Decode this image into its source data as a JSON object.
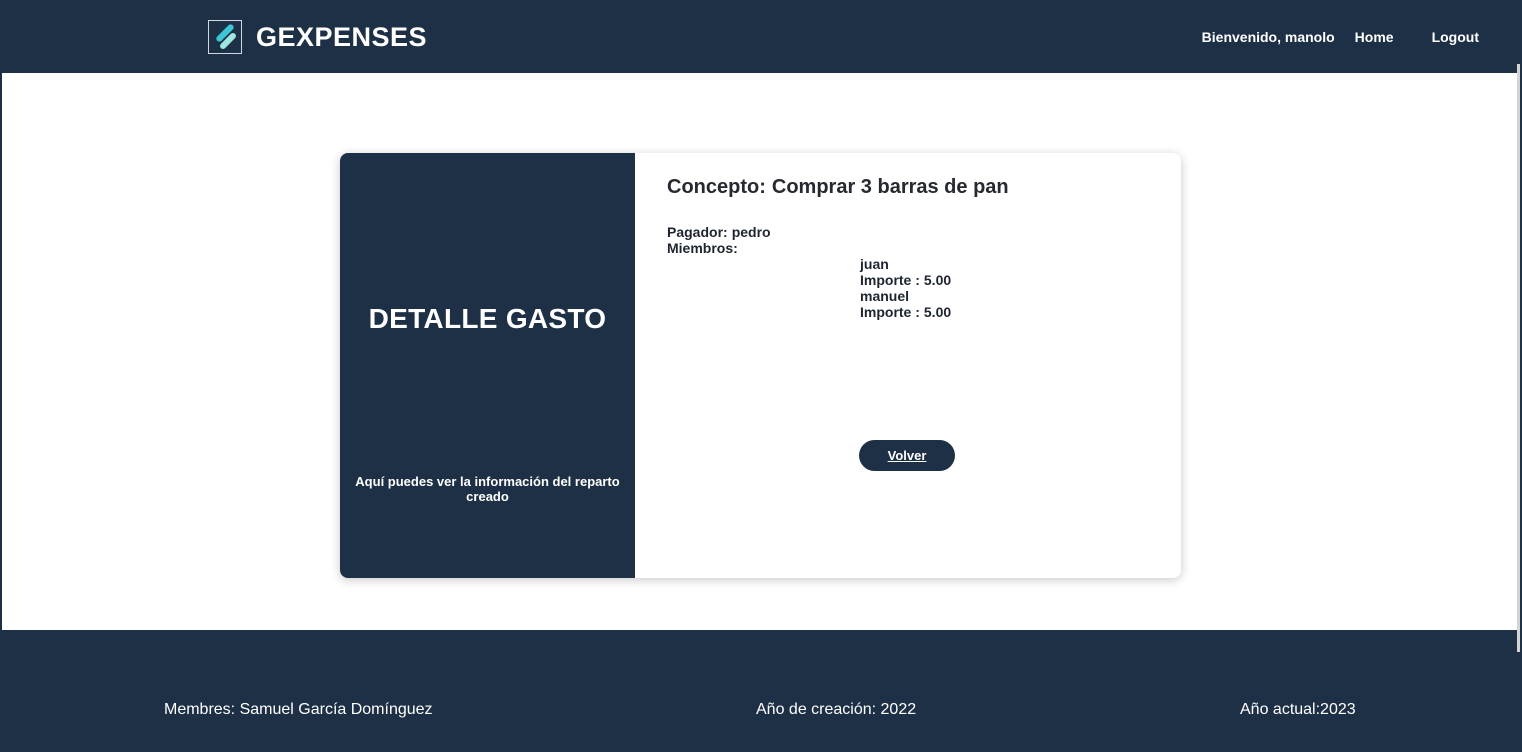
{
  "header": {
    "brand": "GEXPENSES",
    "welcome": "Bienvenido, manolo",
    "home": "Home",
    "logout": "Logout"
  },
  "card": {
    "title": "DETALLE GASTO",
    "subtitle": "Aquí puedes ver la información del reparto creado",
    "concept_label": "Concepto:",
    "concept_value": "Comprar 3 barras de pan",
    "payer_label": "Pagador:",
    "payer_value": "pedro",
    "members_label": "Miembros:",
    "members": [
      {
        "name": "juan",
        "amount_label": "Importe :",
        "amount": "5.00"
      },
      {
        "name": "manuel",
        "amount_label": "Importe :",
        "amount": "5.00"
      }
    ],
    "back_button": "Volver"
  },
  "footer": {
    "members": "Membres: Samuel García Domínguez",
    "created": "Año de creación: 2022",
    "current": "Año actual:2023"
  },
  "colors": {
    "primary": "#1e3046",
    "logo_accent_1": "#3cc7d6",
    "logo_accent_2": "#9ee6e0"
  }
}
